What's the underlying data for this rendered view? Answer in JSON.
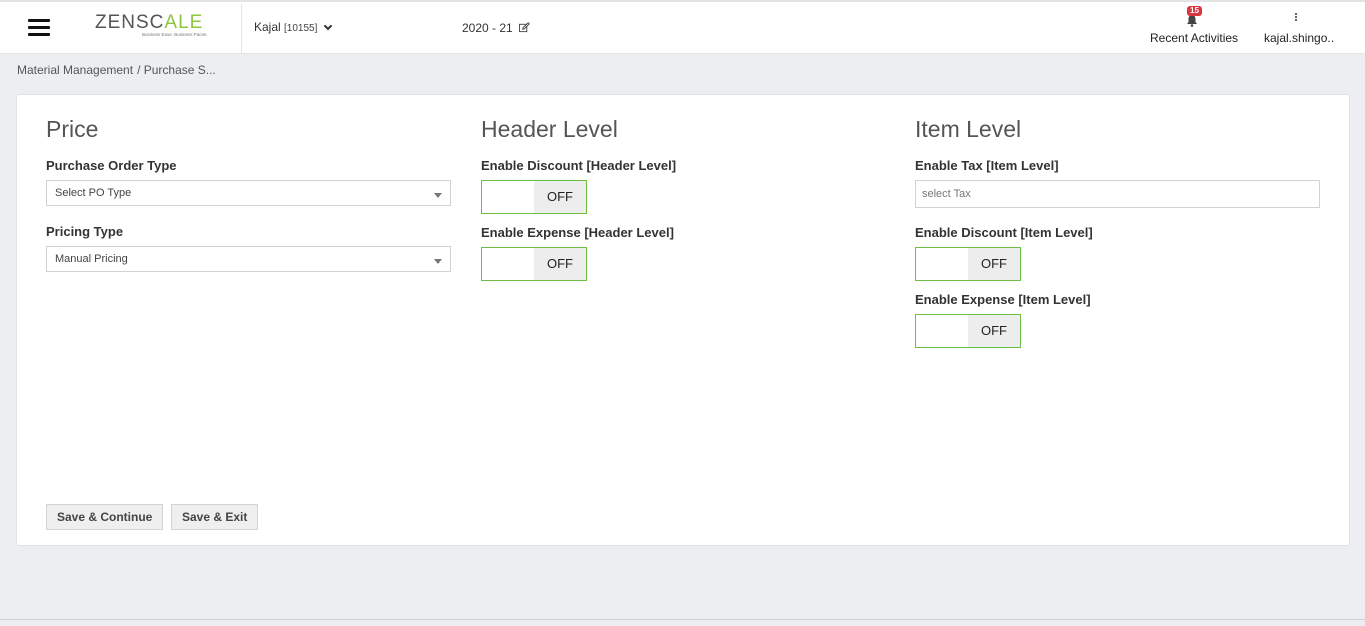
{
  "header": {
    "logo": {
      "text_left": "ZENSC",
      "text_accent": "A",
      "text_right": "LE",
      "tagline": "Business Ease. Business Pacee.",
      "accent_color": "#8cc63f"
    },
    "company": {
      "name": "Kajal",
      "code": "[10155]"
    },
    "financial_year": "2020 - 21",
    "notifications": {
      "count": "15",
      "label": "Recent Activities"
    },
    "user": {
      "name": "kajal.shingo.."
    }
  },
  "breadcrumb": {
    "root": "Material Management",
    "current": "/ Purchase S..."
  },
  "price": {
    "title": "Price",
    "po_type_label": "Purchase Order Type",
    "po_type_value": "Select PO Type",
    "pricing_type_label": "Pricing Type",
    "pricing_type_value": "Manual Pricing"
  },
  "header_level": {
    "title": "Header Level",
    "discount_label": "Enable Discount [Header Level]",
    "discount_state": "OFF",
    "expense_label": "Enable Expense [Header Level]",
    "expense_state": "OFF"
  },
  "item_level": {
    "title": "Item Level",
    "tax_label": "Enable Tax [Item Level]",
    "tax_placeholder": "select Tax",
    "discount_label": "Enable Discount [Item Level]",
    "discount_state": "OFF",
    "expense_label": "Enable Expense [Item Level]",
    "expense_state": "OFF"
  },
  "actions": {
    "save_continue": "Save & Continue",
    "save_exit": "Save & Exit"
  },
  "colors": {
    "toggle_border": "#6fbe44",
    "badge": "#d9363e",
    "page_bg": "#eceef2"
  }
}
